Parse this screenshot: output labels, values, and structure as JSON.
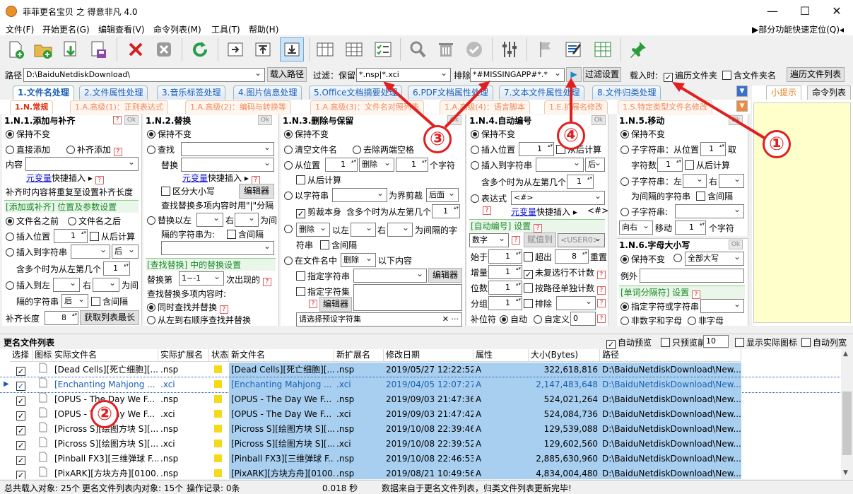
{
  "window": {
    "title": "菲菲更名宝贝 之 得意非凡 4.0",
    "min": "—",
    "max": "☐",
    "close": "✕"
  },
  "menu": {
    "items": [
      "文件(F)",
      "开始更名(G)",
      "编辑查看(V)",
      "命令列表(M)",
      "工具(T)",
      "帮助(H)"
    ],
    "right": "▶部分功能快速定位(Q)◂"
  },
  "path": {
    "label": "路径",
    "value": "D:\\BaiduNetdiskDownload\\",
    "load": "载入路径"
  },
  "filter": {
    "label": "过滤：保留",
    "keep": "*.nsp|*.xci",
    "excl_label": "排除",
    "exclude": "*#MISSINGAPP#*.*",
    "apply": "过滤设置"
  },
  "load_opts": {
    "label": "载入时:",
    "traverse": "遍历文件夹",
    "with_folder": "含文件夹名",
    "traverse_list": "遍历文件列表"
  },
  "tabs": [
    "1.文件名处理",
    "2.文件属性处理",
    "3.音乐标签处理",
    "4.图片信息处理",
    "5.Office文档摘要处理",
    "6.PDF文档属性处理",
    "7.文本文件属性处理",
    "8.文件归类处理"
  ],
  "subtabs": [
    "1.N.常规",
    "1.A.高级(1)：正则表达式",
    "1.A.高级(2)：编码与转换等",
    "1.A.高级(3)：文件名对照列表",
    "1.A.高级(4)：语言脚本",
    "1.E.扩展名修改",
    "1.S.特定类型文件名修改"
  ],
  "side": {
    "tip": "小提示",
    "cmds": "命令列表"
  },
  "p1": {
    "title": "1.N.1.添加与补齐",
    "keep": "保持不变",
    "direct": "直接添加",
    "pad": "补齐添加",
    "content": "内容",
    "var": "元变量",
    "quick": "快捷插入 ▸",
    "note": "补齐时内容将重复至设置补齐长度",
    "sec": "[添加或补齐] 位置及参数设置",
    "before": "文件名之前",
    "after": "文件名之后",
    "insert_pos": "插入位置",
    "pos_val": "1",
    "from_end": "从后计算",
    "insert_str": "插入到字符串",
    "back": "后",
    "multi": "含多个时为从左第几个",
    "multi_val": "1",
    "insert_lr": "插入到左",
    "right": "右",
    "as_between": "为间",
    "between_str": "隔的字符串",
    "contain_gap": "含间隔",
    "pad_len": "补齐长度",
    "pad_val": "8",
    "get_max": "获取列表最长"
  },
  "p2": {
    "title": "1.N.2.替换",
    "keep": "保持不变",
    "find": "查找",
    "replace": "替换",
    "var": "元变量",
    "quick": "快捷插入 ▸",
    "case": "区分大小写",
    "editor": "编辑器",
    "multi_note": "查找替换多项内容时用\"|\"分隔",
    "lr": "替换以左",
    "right": "右",
    "as_between": "为间",
    "between_str": "隔的字符串为:",
    "gap": "含间隔",
    "sec": "[查找替换] 中的替换设置",
    "nth_label": "替换第",
    "nth": "1~-1",
    "nth_suffix": "次出现的",
    "multi_find": "查找替换多项内容时:",
    "sim": "同时查找并替换",
    "seq": "从左到右顺序查找并替换"
  },
  "p3": {
    "title": "1.N.3.删除与保留",
    "keep": "保持不变",
    "clear": "清空文件名",
    "trim": "去除两端空格",
    "from_pos": "从位置",
    "pos": "1",
    "del": "删除",
    "cnt": "1",
    "unit": "个字符",
    "from_end": "从后计算",
    "by_str": "以字符串",
    "cut": "为界剪裁",
    "after": "后面",
    "cut_self": "剪裁本身",
    "multi": "含多个时为从左第几个",
    "multi_val": "1",
    "del2": "删除",
    "lr": "以左",
    "right": "右",
    "between": "为间隔的字",
    "str": "符串",
    "gap": "含间隔",
    "in_name": "在文件名中",
    "del3": "删除",
    "below": "以下内容",
    "spec_str": "指定字符串",
    "spec_set": "指定字符集",
    "editor": "编辑器",
    "preset": "请选择预设字符集"
  },
  "p4": {
    "title": "1.N.4.自动编号",
    "keep": "保持不变",
    "insert_pos": "插入位置",
    "pos": "1",
    "from_end": "从后计算",
    "insert_str": "插入到字符串",
    "back": "后",
    "multi": "含多个时为从左第几个",
    "multi_val": "1",
    "expr": "表达式",
    "expr_val": "<#>",
    "var": "元变量",
    "quick": "快捷插入 ▸",
    "hash": "<#>",
    "sec": "[自动编号] 设置",
    "num": "数字",
    "assign": "赋值到",
    "user": "<USER0>",
    "start": "始于",
    "start_v": "1",
    "over": "超出",
    "over_v": "8",
    "reset": "重置",
    "step": "增量",
    "step_v": "1",
    "unselected": "未复选行不计数",
    "digits": "位数",
    "digits_v": "1",
    "by_path": "按路径单独计数",
    "group": "分组",
    "group_v": "1",
    "exclude": "排除",
    "padchar": "补位符",
    "auto": "自动",
    "custom": "自定义",
    "custom_v": "0"
  },
  "p5": {
    "title": "1.N.5.移动",
    "keep": "保持不变",
    "substr": "子字符串：从位置",
    "pos": "1",
    "take": "取",
    "cnt_label": "字符数",
    "cnt": "1",
    "from_end": "从后计算",
    "substr2": "子字符串：左",
    "right": "右",
    "between": "为间隔的字符串",
    "gap": "含间隔",
    "substr3": "子字符串:",
    "dir": "向右",
    "move": "移动",
    "mv": "1",
    "unit": "个字符"
  },
  "p6": {
    "title": "1.N.6.字母大小写",
    "keep": "保持不变",
    "all_upper": "全部大写",
    "exception": "例外",
    "sec": "[单词分隔符] 设置",
    "spec": "指定字符或字符串",
    "nonalnum": "非数字和字母",
    "nonletter": "非字母"
  },
  "list": {
    "title": "更名文件列表",
    "auto_preview": "自动预览",
    "only_first": "只预览前",
    "first_n": "10",
    "show_icon": "显示实际图标",
    "auto_width": "自动列宽"
  },
  "columns": [
    "选择",
    "图标",
    "实际文件名",
    "实际扩展名",
    "状态",
    "新文件名",
    "新扩展名",
    "修改日期",
    "属性",
    "大小(Bytes)",
    "路径"
  ],
  "rows": [
    {
      "name": "[Dead Cells][死亡细胞][...",
      "ext": ".nsp",
      "newname": "[Dead Cells][死亡细胞][...",
      "newext": ".nsp",
      "date": "2019/05/27 12:22:52",
      "attr": "A",
      "size": "322,618,816",
      "path": "D:\\BaiduNetdiskDownload\\New..."
    },
    {
      "name": "[Enchanting Mahjong ...",
      "ext": ".xci",
      "newname": "[Enchanting Mahjong ...",
      "newext": ".xci",
      "date": "2019/04/05 12:07:27",
      "attr": "A",
      "size": "2,147,483,648",
      "path": "D:\\BaiduNetdiskDownload\\New..."
    },
    {
      "name": "[OPUS - The Day We F...",
      "ext": ".nsp",
      "newname": "[OPUS - The Day We F...",
      "newext": ".nsp",
      "date": "2019/09/03 21:47:36",
      "attr": "A",
      "size": "524,021,264",
      "path": "D:\\BaiduNetdiskDownload\\New..."
    },
    {
      "name": "[OPUS - The Day We F...",
      "ext": ".xci",
      "newname": "[OPUS - The Day We F...",
      "newext": ".xci",
      "date": "2019/09/03 21:47:42",
      "attr": "A",
      "size": "524,084,736",
      "path": "D:\\BaiduNetdiskDownload\\New..."
    },
    {
      "name": "[Picross S][绘图方块 S][...",
      "ext": ".nsp",
      "newname": "[Picross S][绘图方块 S][...",
      "newext": ".nsp",
      "date": "2019/10/08 22:39:46",
      "attr": "A",
      "size": "129,539,088",
      "path": "D:\\BaiduNetdiskDownload\\New..."
    },
    {
      "name": "[Picross S][绘图方块 S][...",
      "ext": ".xci",
      "newname": "[Picross S][绘图方块 S][...",
      "newext": ".xci",
      "date": "2019/10/08 22:39:52",
      "attr": "A",
      "size": "129,602,560",
      "path": "D:\\BaiduNetdiskDownload\\New..."
    },
    {
      "name": "[Pinball FX3][三维弹球 F...",
      "ext": ".nsp",
      "newname": "[Pinball FX3][三维弹球 F...",
      "newext": ".nsp",
      "date": "2019/10/08 22:46:53",
      "attr": "A",
      "size": "2,885,630,960",
      "path": "D:\\BaiduNetdiskDownload\\New..."
    },
    {
      "name": "[PixARK][方块方舟][0100...",
      "ext": ".nsp",
      "newname": "[PixARK][方块方舟][0100...",
      "newext": ".nsp",
      "date": "2019/08/21 10:49:56",
      "attr": "A",
      "size": "4,834,004,480",
      "path": "D:\\BaiduNetdiskDownload\\New..."
    }
  ],
  "status": {
    "total": "总共载入对象: 25个",
    "in_list": "更名文件列表内对象: 15个",
    "ops": "操作记录: 0条",
    "time": "0.018 秒",
    "msg": "数据来自于更名文件列表，归类文件列表更新完毕!"
  },
  "annotations": [
    "①",
    "②",
    "③",
    "④"
  ],
  "colors": {
    "accent": "#1a5fb4",
    "annotation": "#e02020",
    "new_name_bg": "#a9cff0"
  }
}
